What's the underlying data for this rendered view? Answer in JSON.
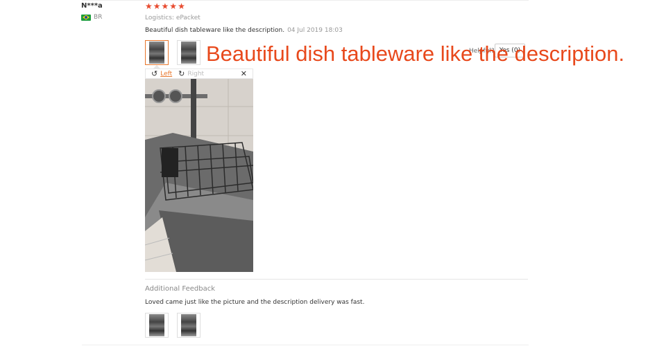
{
  "review": {
    "user_name": "N***a",
    "country_code": "BR",
    "stars": [
      "★",
      "★",
      "★",
      "★",
      "★"
    ],
    "rating_color": "#e84b2f",
    "logistics": "Logistics: ePacket",
    "text": "Beautiful dish tableware like the description.",
    "date": "04 Jul 2019 18:03",
    "helpful_label": "Helpful?",
    "yes_label": "Yes (0)"
  },
  "overlay_caption": "Beautiful dish tableware like the description.",
  "image_viewer": {
    "rotate_left_label": "Left",
    "rotate_right_label": "Right",
    "close_glyph": "✕",
    "rotate_left_glyph": "↺",
    "rotate_right_glyph": "↻"
  },
  "additional": {
    "title": "Additional Feedback",
    "text": "Loved came just like the picture and the description delivery was fast."
  },
  "colors": {
    "accent": "#e8762b",
    "caption": "#e8491c"
  }
}
